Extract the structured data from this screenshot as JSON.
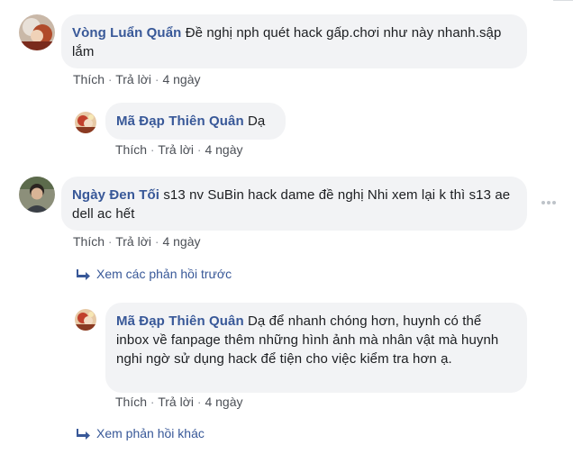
{
  "comments": [
    {
      "author": "Vòng Luẩn Quẩn",
      "text": "Đề nghị nph quét hack gấp.chơi như này nhanh.sập lắm",
      "actions": {
        "like": "Thích",
        "reply": "Trả lời",
        "time": "4 ngày"
      },
      "avatar_icon": "user-avatar-icon"
    },
    {
      "author": "Mã Đạp Thiên Quân",
      "text": "Dạ",
      "actions": {
        "like": "Thích",
        "reply": "Trả lời",
        "time": "4 ngày"
      },
      "avatar_icon": "page-avatar-icon"
    },
    {
      "author": "Ngày Đen Tối",
      "text": "s13 nv SuBin hack dame đề nghị Nhi xem lại k thì s13 ae dell ac hết",
      "actions": {
        "like": "Thích",
        "reply": "Trả lời",
        "time": "4 ngày"
      },
      "avatar_icon": "user-avatar-icon"
    },
    {
      "author": "Mã Đạp Thiên Quân",
      "text": "Dạ để nhanh chóng hơn, huynh có thể inbox về fanpage thêm những hình ảnh mà nhân vật mà huynh nghi ngờ sử dụng hack để tiện cho việc kiểm tra hơn ạ.",
      "actions": {
        "like": "Thích",
        "reply": "Trả lời",
        "time": "4 ngày"
      },
      "avatar_icon": "page-avatar-icon"
    }
  ],
  "links": {
    "previous_replies": "Xem các phản hồi trước",
    "more_replies": "Xem phản hồi khác"
  },
  "separator": "·",
  "colors": {
    "author": "#385898",
    "bubble": "#f2f3f5",
    "meta": "#606770",
    "link": "#385898"
  }
}
